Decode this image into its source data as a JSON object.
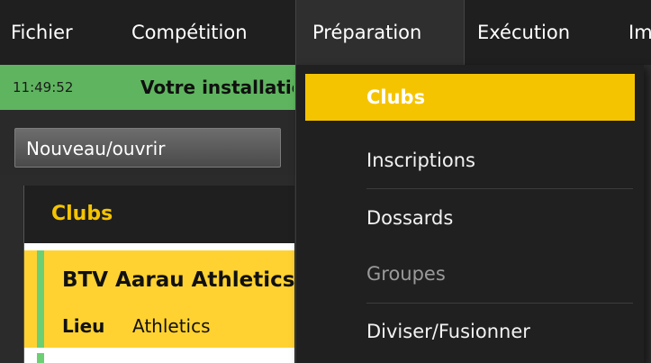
{
  "menubar": {
    "items": [
      {
        "label": "Fichier"
      },
      {
        "label": "Compétition"
      },
      {
        "label": "Préparation"
      },
      {
        "label": "Exécution"
      },
      {
        "label": "Im"
      }
    ]
  },
  "status": {
    "time": "11:49:52",
    "message": "Votre installation"
  },
  "toolbar": {
    "new_open_label": "Nouveau/ouvrir"
  },
  "panel": {
    "title": "Clubs",
    "selected_row": {
      "name": "BTV Aarau Athletics",
      "location_label": "Lieu",
      "location_value": "Athletics"
    }
  },
  "dropdown": {
    "items": [
      {
        "label": "Clubs",
        "state": "selected"
      },
      {
        "label": "Inscriptions",
        "state": "normal"
      },
      {
        "label": "Dossards",
        "state": "normal"
      },
      {
        "label": "Groupes",
        "state": "disabled"
      },
      {
        "label": "Diviser/Fusionner",
        "state": "normal"
      }
    ]
  },
  "colors": {
    "accent": "#f5c400",
    "status_bar": "#5fb55f",
    "row_marker": "#6ccf73"
  }
}
